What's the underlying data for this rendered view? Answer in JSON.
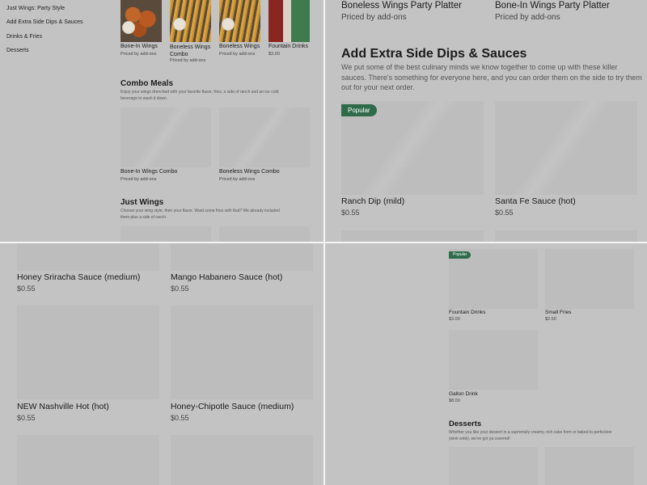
{
  "sidebar": {
    "items": [
      "Just Wings: Party Style",
      "Add Extra Side Dips & Sauces",
      "Drinks & Fries",
      "Desserts"
    ]
  },
  "top_items": [
    {
      "name": "Bone-In Wings",
      "price": "Priced by add-ons",
      "image": "wings-photo"
    },
    {
      "name": "Boneless Wings Combo",
      "price": "Priced by add-ons",
      "image": "fries-photo"
    },
    {
      "name": "Boneless Wings",
      "price": "Priced by add-ons",
      "image": "fries-photo"
    },
    {
      "name": "Fountain Drinks",
      "price": "$3.00",
      "image": "drinks-photo"
    }
  ],
  "combo": {
    "title": "Combo Meals",
    "desc_line1": "Enjoy your wings drenched with your favorite flavor, fries, a side of ranch and an ice cold",
    "desc_line2": "beverage to wash it down.",
    "items": [
      {
        "name": "Bone-In Wings Combo",
        "price": "Priced by add-ons"
      },
      {
        "name": "Boneless Wings Combo",
        "price": "Priced by add-ons"
      }
    ]
  },
  "just_wings": {
    "title": "Just Wings",
    "desc_line1": "Choose your wing style, then your flavor. Want some fries with that? We already included",
    "desc_line2": "them plus a side of ranch."
  },
  "platters": [
    {
      "name": "Boneless Wings Party Platter",
      "price": "Priced by add-ons"
    },
    {
      "name": "Bone-In Wings Party Platter",
      "price": "Priced by add-ons"
    }
  ],
  "sauces": {
    "title": "Add Extra Side Dips & Sauces",
    "desc_line1": "We put some of the best culinary minds we know together to come up with these killer",
    "desc_line2": "sauces. There's something for everyone here, and you can order them on the side to try them",
    "desc_line3": "out for your next order.",
    "badge": "Popular",
    "items": [
      {
        "name": "Ranch Dip (mild)",
        "price": "$0.55"
      },
      {
        "name": "Santa Fe Sauce (hot)",
        "price": "$0.55"
      },
      {
        "name": "Honey Sriracha Sauce (medium)",
        "price": "$0.55"
      },
      {
        "name": "Mango Habanero Sauce (hot)",
        "price": "$0.55"
      },
      {
        "name": "NEW Nashville Hot (hot)",
        "price": "$0.55"
      },
      {
        "name": "Honey-Chipotle Sauce (medium)",
        "price": "$0.55"
      }
    ]
  },
  "drinks": {
    "badge": "Popular",
    "items": [
      {
        "name": "Fountain Drinks",
        "price": "$3.00"
      },
      {
        "name": "Small Fries",
        "price": "$2.50"
      },
      {
        "name": "Gallon Drink",
        "price": "$8.00"
      }
    ]
  },
  "desserts": {
    "title": "Desserts",
    "desc_line1": "Whether you like your dessert in a supremely creamy, rich cake form or baked to perfection",
    "desc_line2": "(wink wink), we've got ya covered!"
  }
}
